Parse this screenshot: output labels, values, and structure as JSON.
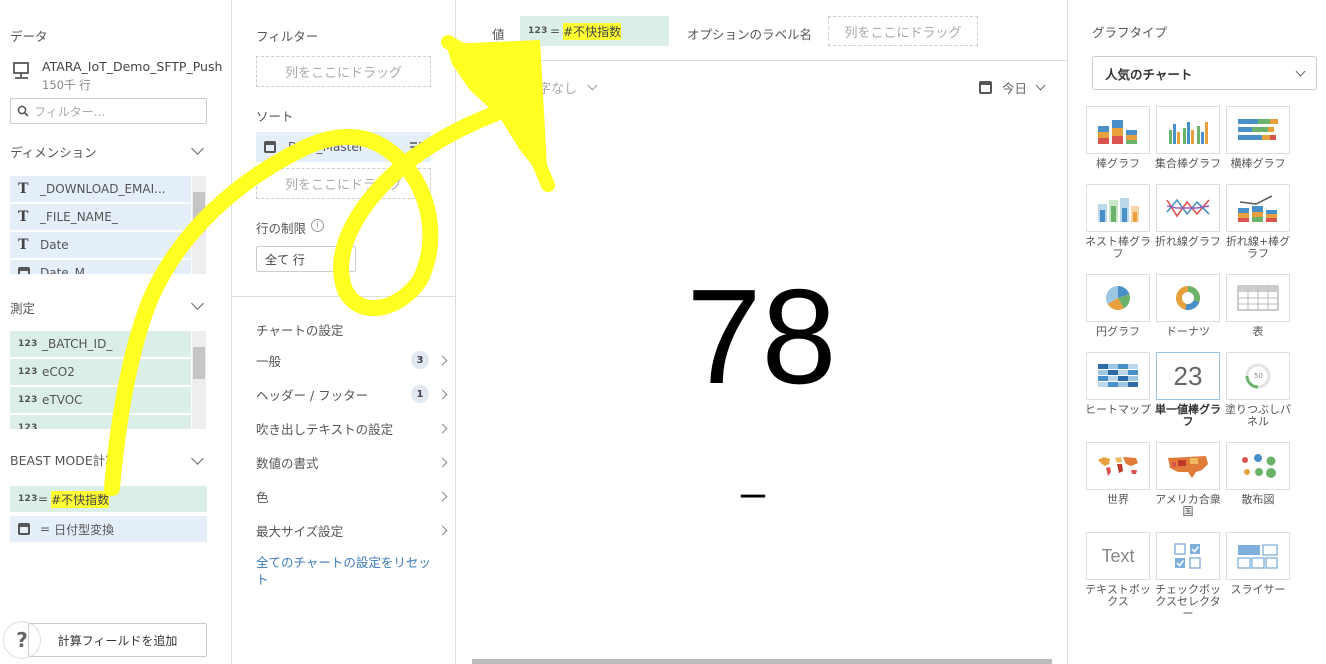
{
  "left": {
    "data_title": "データ",
    "dataset_name": "ATARA_IoT_Demo_SFTP_Push",
    "dataset_rows": "150千 行",
    "filter_placeholder": "フィルター...",
    "dimensions_title": "ディメンション",
    "dimensions": [
      "_DOWNLOAD_EMAI...",
      "_FILE_NAME_",
      "Date",
      "Date_M..."
    ],
    "measures_title": "測定",
    "measures": [
      "_BATCH_ID_",
      "eCO2",
      "eTVOC",
      "..."
    ],
    "beast_title": "BEAST MODE計算",
    "beast_items": [
      {
        "prefix": "123",
        "eq": "=",
        "name": "#不快指数"
      },
      {
        "eq": "=",
        "name": "日付型変換"
      }
    ],
    "add_calc_label": "計算フィールドを追加",
    "help_glyph": "?"
  },
  "middle": {
    "filter_title": "フィルター",
    "drop_hint": "列をここにドラッグ",
    "sort_title": "ソート",
    "sort_field": "Date_Master",
    "row_limit_title": "行の制限",
    "info_glyph": "i",
    "row_limit_value": "全て 行",
    "chart_settings_title": "チャートの設定",
    "settings": [
      {
        "label": "一般",
        "badge": "3"
      },
      {
        "label": "ヘッダー / フッター",
        "badge": "1"
      },
      {
        "label": "吹き出しテキストの設定",
        "badge": ""
      },
      {
        "label": "数値の書式",
        "badge": ""
      },
      {
        "label": "色",
        "badge": ""
      },
      {
        "label": "最大サイズ設定",
        "badge": ""
      }
    ],
    "reset_link": "全てのチャートの設定をリセット"
  },
  "main": {
    "value_label": "値",
    "value_prefix": "123",
    "value_eq": "=",
    "value_field": "#不快指数",
    "option_label": "オプションのラベル名",
    "option_drop": "列をここにドラッグ",
    "summary_label": "まとめ数字なし",
    "date_label": "今日",
    "big_value": "78",
    "sub_value": "–"
  },
  "right": {
    "graph_type_title": "グラフタイプ",
    "graph_select": "人気のチャート",
    "tiles": [
      {
        "name": "bar",
        "label": "棒グラフ"
      },
      {
        "name": "grouped-bar",
        "label": "集合棒グラフ"
      },
      {
        "name": "horizontal-bar",
        "label": "横棒グラフ"
      },
      {
        "name": "nested-bar",
        "label": "ネスト棒グラフ"
      },
      {
        "name": "line",
        "label": "折れ線グラフ"
      },
      {
        "name": "line-bar",
        "label": "折れ線+棒グラフ"
      },
      {
        "name": "pie",
        "label": "円グラフ"
      },
      {
        "name": "donut",
        "label": "ドーナツ"
      },
      {
        "name": "table",
        "label": "表"
      },
      {
        "name": "heatmap",
        "label": "ヒートマップ"
      },
      {
        "name": "single-value",
        "label": "単一値棒グラフ",
        "glyph": "23"
      },
      {
        "name": "filled-gauge",
        "label": "塗りつぶしパネル",
        "glyph": "50"
      },
      {
        "name": "world",
        "label": "世界"
      },
      {
        "name": "usa",
        "label": "アメリカ合衆国"
      },
      {
        "name": "scatter",
        "label": "散布図"
      },
      {
        "name": "textbox",
        "label": "テキストボックス",
        "glyph": "Text"
      },
      {
        "name": "checkbox-selector",
        "label": "チェックボックスセレクター"
      },
      {
        "name": "slicer",
        "label": "スライサー"
      }
    ]
  },
  "colors": {
    "highlight": "#ffff33",
    "dimension_bg": "#e4eff9",
    "measure_bg": "#dbeee8",
    "link": "#3b7bbf"
  }
}
